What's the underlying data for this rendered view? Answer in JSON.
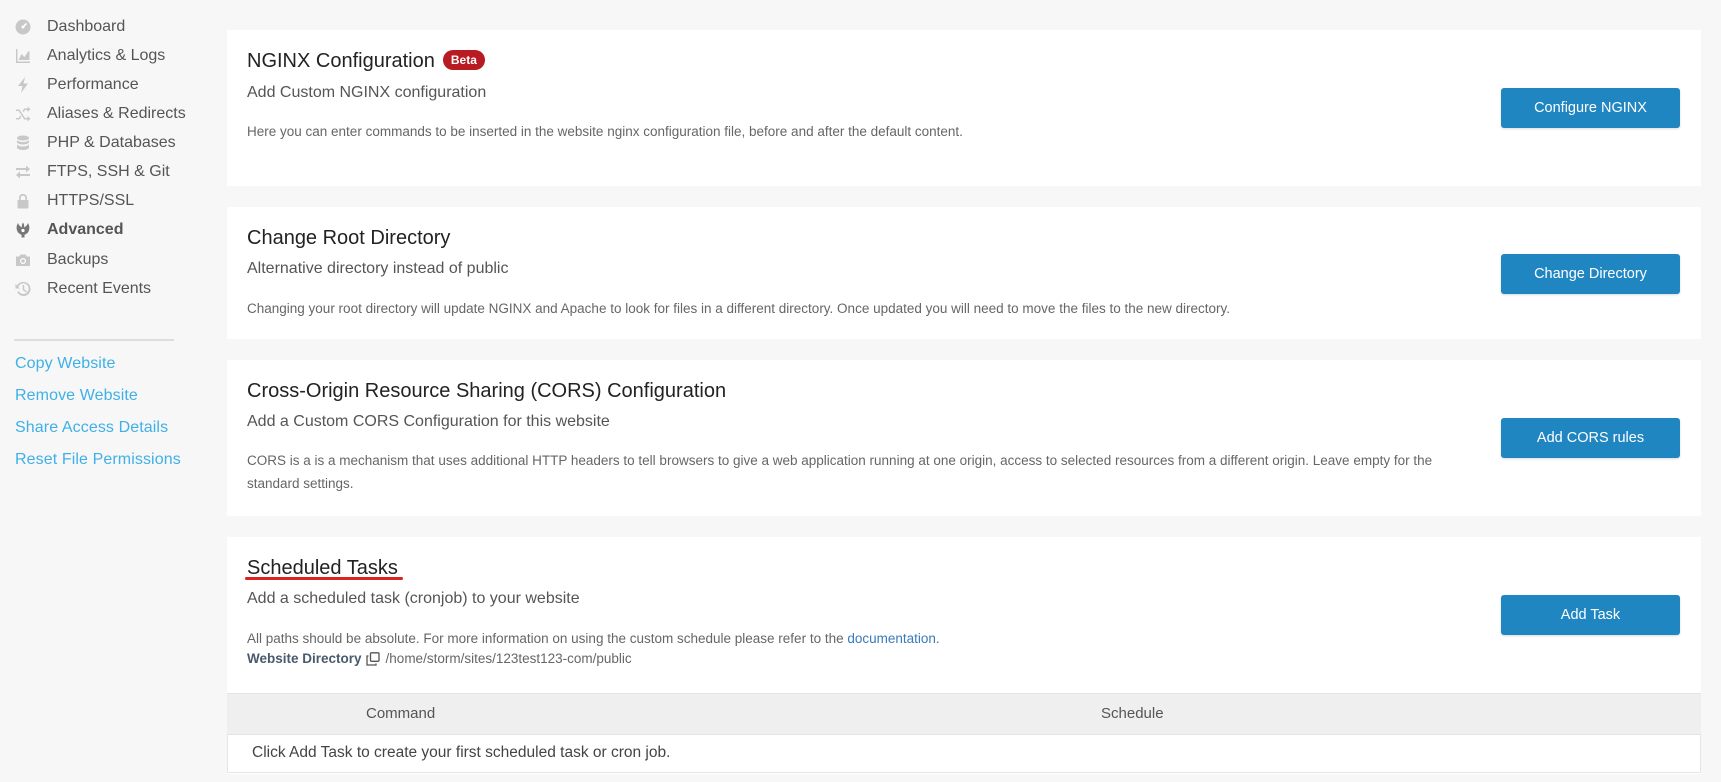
{
  "sidebar": {
    "items": [
      {
        "label": "Dashboard",
        "icon": "dashboard-icon"
      },
      {
        "label": "Analytics & Logs",
        "icon": "chart-icon"
      },
      {
        "label": "Performance",
        "icon": "bolt-icon"
      },
      {
        "label": "Aliases & Redirects",
        "icon": "shuffle-icon"
      },
      {
        "label": "PHP & Databases",
        "icon": "database-icon"
      },
      {
        "label": "FTPS, SSH & Git",
        "icon": "transfer-icon"
      },
      {
        "label": "HTTPS/SSL",
        "icon": "lock-icon"
      },
      {
        "label": "Advanced",
        "icon": "advanced-icon",
        "active": true
      },
      {
        "label": "Backups",
        "icon": "camera-icon"
      },
      {
        "label": "Recent Events",
        "icon": "history-icon"
      }
    ],
    "links": [
      {
        "label": "Copy Website"
      },
      {
        "label": "Remove Website"
      },
      {
        "label": "Share Access Details"
      },
      {
        "label": "Reset File Permissions"
      }
    ]
  },
  "nginx": {
    "title": "NGINX Configuration",
    "badge": "Beta",
    "subtitle": "Add Custom NGINX configuration",
    "description": "Here you can enter commands to be inserted in the website nginx configuration file, before and after the default content.",
    "button": "Configure NGINX"
  },
  "root_dir": {
    "title": "Change Root Directory",
    "subtitle": "Alternative directory instead of public",
    "description": "Changing your root directory will update NGINX and Apache to look for files in a different directory. Once updated you will need to move the files to the new directory.",
    "button": "Change Directory"
  },
  "cors": {
    "title": "Cross-Origin Resource Sharing (CORS) Configuration",
    "subtitle": "Add a Custom CORS Configuration for this website",
    "description_line1": "CORS is a is a mechanism that uses additional HTTP headers to tell browsers to give a web application running at one origin, access to selected resources from a different origin. Leave empty for the",
    "description_line2": "standard settings.",
    "button": "Add CORS rules"
  },
  "tasks": {
    "title": "Scheduled Tasks",
    "subtitle": "Add a scheduled task (cronjob) to your website",
    "description_prefix": "All paths should be absolute. For more information on using the custom schedule please refer to the ",
    "description_link": "documentation",
    "description_suffix": ".",
    "dir_label": "Website Directory",
    "dir_path": "/home/storm/sites/123test123-com/public",
    "button": "Add Task",
    "columns": [
      "Command",
      "Schedule"
    ],
    "empty_message": "Click Add Task to create your first scheduled task or cron job."
  },
  "colors": {
    "primary_button": "#1f86c2",
    "badge": "#b81c22",
    "sidebar_link": "#3fb0e8",
    "highlight_underline": "#dd2222"
  }
}
